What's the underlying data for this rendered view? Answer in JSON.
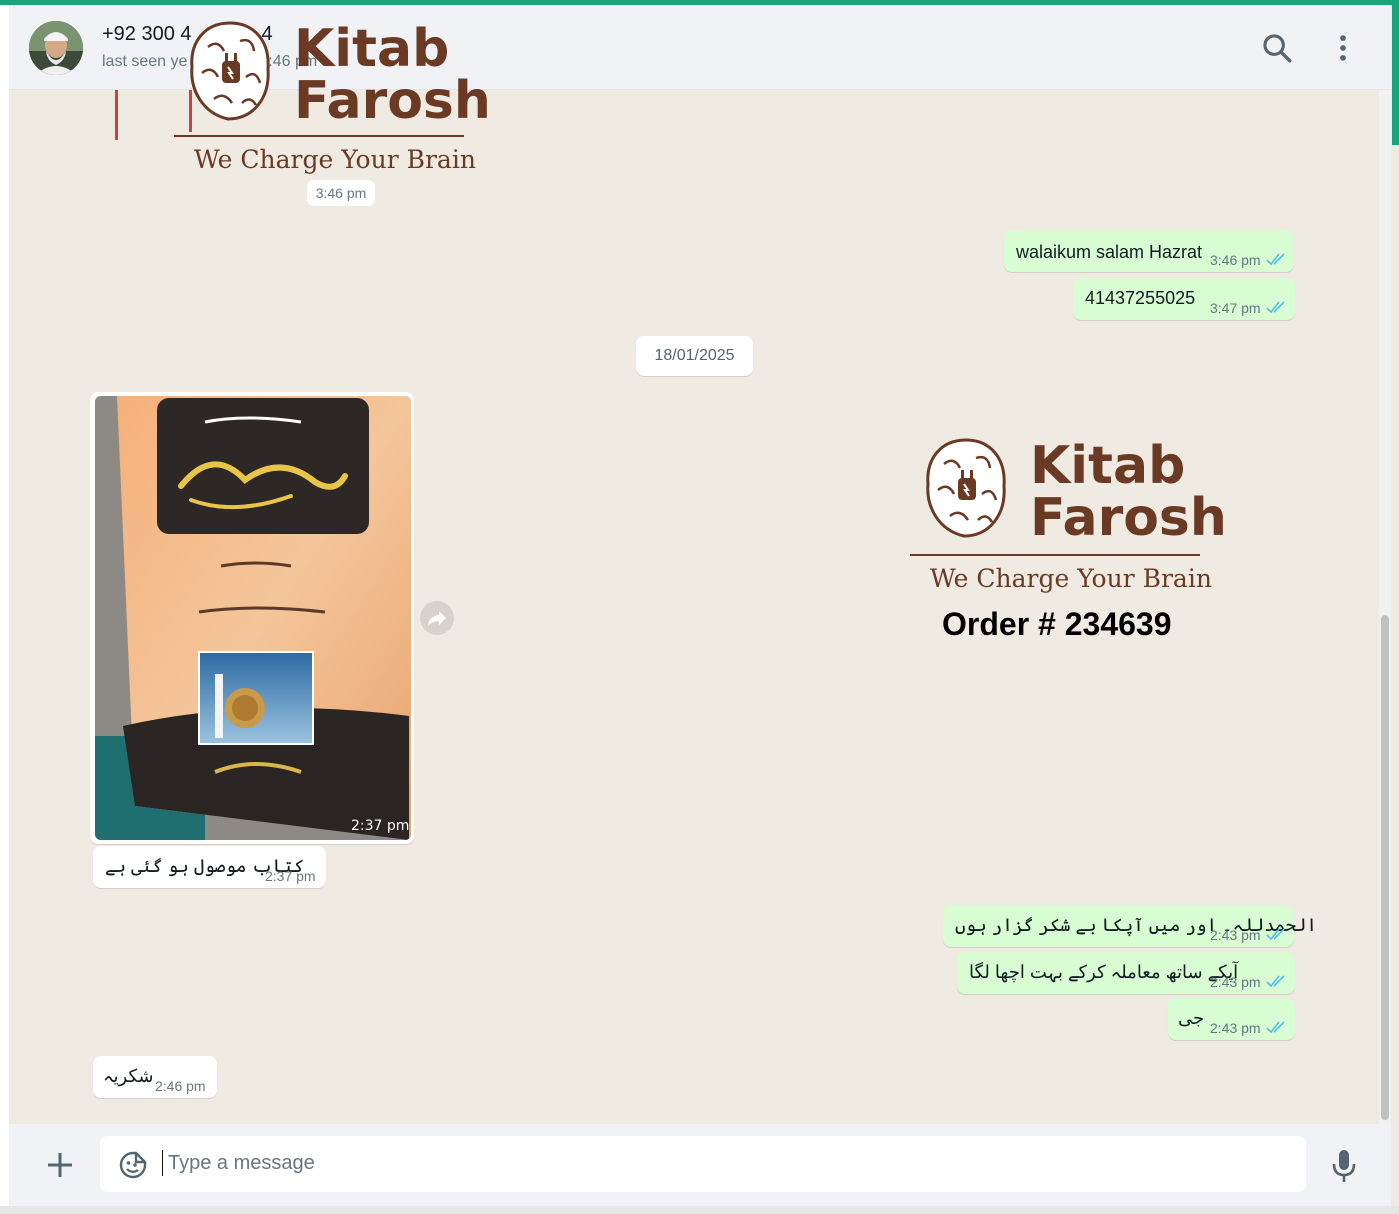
{
  "header": {
    "contact_name": "+92 300 4",
    "contact_name_tail": "4",
    "last_seen": "last seen ye",
    "last_seen_tail": "9:46 pm",
    "icons": [
      "search-icon",
      "more-options-icon"
    ]
  },
  "watermark": {
    "brand_line1": "Kitab",
    "brand_line2": "Farosh",
    "tagline": "We Charge Your Brain",
    "order": "Order # 234639"
  },
  "chat": {
    "time_chip": "3:46 pm",
    "date_chip": "18/01/2025",
    "messages": [
      {
        "dir": "out",
        "text": "walaikum salam Hazrat",
        "time": "3:46 pm"
      },
      {
        "dir": "out",
        "text": "41437255025",
        "time": "3:47 pm"
      },
      {
        "dir": "in",
        "type": "image",
        "time": "2:37 pm",
        "book_title": "نقوشِ سیرت",
        "book_header": "علی هامش السیرة",
        "author_label": "مصنف",
        "author": "ڈاکٹر طہٰ حسین",
        "translator_label": "مترجم",
        "translator": "پروفیسر حافظ سید رشید احمد ارشد",
        "publisher": "نفیس اکیڈمی"
      },
      {
        "dir": "in",
        "text": "کتاب موصول ہو گئی ہے",
        "time": "2:37 pm"
      },
      {
        "dir": "out",
        "text": "الحمدللہ۔ اور میں آپکا بے شکر گزار ہوں",
        "time": "2:43 pm"
      },
      {
        "dir": "out",
        "text": "آپکے ساتھ معاملہ کرکے بہت اچھا لگا",
        "time": "2:43 pm"
      },
      {
        "dir": "out",
        "text": "جی",
        "time": "2:43 pm"
      },
      {
        "dir": "in",
        "text": "شکریہ",
        "time": "2:46 pm"
      }
    ]
  },
  "composer": {
    "placeholder": "Type a message",
    "icons": [
      "plus-icon",
      "emoji-icon",
      "microphone-icon"
    ]
  },
  "colors": {
    "accent": "#18a47d",
    "outgoing_bubble": "#d9fdd3",
    "incoming_bubble": "#ffffff",
    "chat_bg": "#efeae2",
    "read_ticks": "#53bdeb",
    "brand": "#6b3a24"
  }
}
